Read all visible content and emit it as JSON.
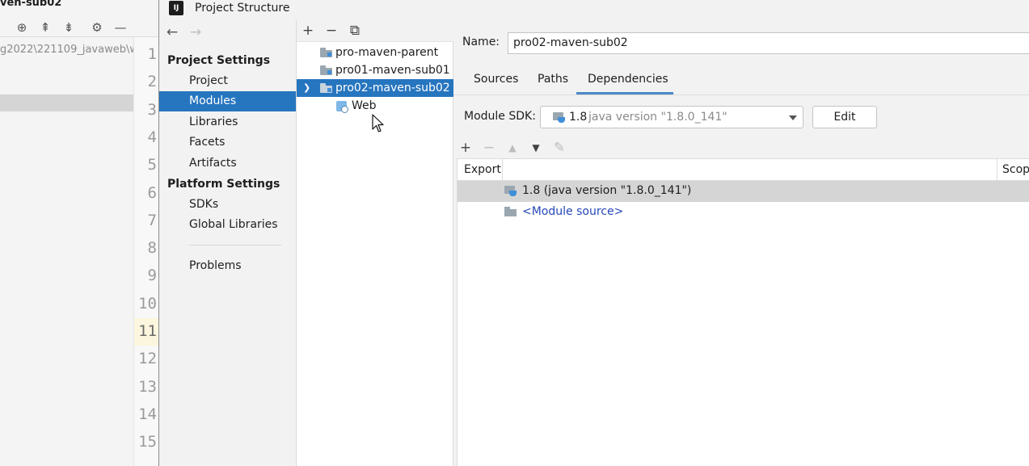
{
  "ide": {
    "title": "ven-sub02",
    "path": "g2022\\221109_javaweb\\w",
    "line_numbers": [
      "1",
      "2",
      "3",
      "4",
      "5",
      "6",
      "7",
      "8",
      "9",
      "10",
      "11",
      "12",
      "13",
      "14",
      "15"
    ],
    "current_line": "11",
    "toolbar_icons": [
      "crosshair-icon",
      "expand-all-icon",
      "collapse-all-icon",
      "gear-icon",
      "minimize-icon"
    ]
  },
  "dialog": {
    "title": "Project Structure",
    "logo_text": "IJ"
  },
  "nav": {
    "back_glyph": "←",
    "forward_glyph": "→",
    "sections": [
      {
        "label": "Project Settings",
        "items": [
          "Project",
          "Modules",
          "Libraries",
          "Facets",
          "Artifacts"
        ]
      },
      {
        "label": "Platform Settings",
        "items": [
          "SDKs",
          "Global Libraries"
        ]
      }
    ],
    "extra_item": "Problems",
    "selected_item": "Modules"
  },
  "tree": {
    "toolbar": {
      "add": "+",
      "remove": "−",
      "copy": "⧉"
    },
    "nodes": [
      {
        "label": "pro-maven-parent",
        "level": 0,
        "selected": false
      },
      {
        "label": "pro01-maven-sub01",
        "level": 0,
        "selected": false
      },
      {
        "label": "pro02-maven-sub02",
        "level": 0,
        "selected": true,
        "expanded": true
      },
      {
        "label": "Web",
        "level": 1,
        "selected": false
      }
    ]
  },
  "content": {
    "name_label": "Name:",
    "name_value": "pro02-maven-sub02",
    "tabs": [
      "Sources",
      "Paths",
      "Dependencies"
    ],
    "active_tab": "Dependencies",
    "sdk_label": "Module SDK:",
    "sdk_value": "1.8",
    "sdk_detail": "java version \"1.8.0_141\"",
    "edit_label": "Edit",
    "dep_toolbar": {
      "add": "+",
      "remove": "−",
      "up": "▲",
      "down": "▼",
      "edit": "✎"
    },
    "columns": [
      "Export",
      "Scop"
    ],
    "dependencies": [
      {
        "label": "1.8 (java version \"1.8.0_141\")",
        "selected": true
      },
      {
        "label": "<Module source>",
        "selected": false
      }
    ]
  },
  "colors": {
    "selection": "#2675bf",
    "tab_underline": "#4a88c7",
    "link": "#2547b8"
  }
}
